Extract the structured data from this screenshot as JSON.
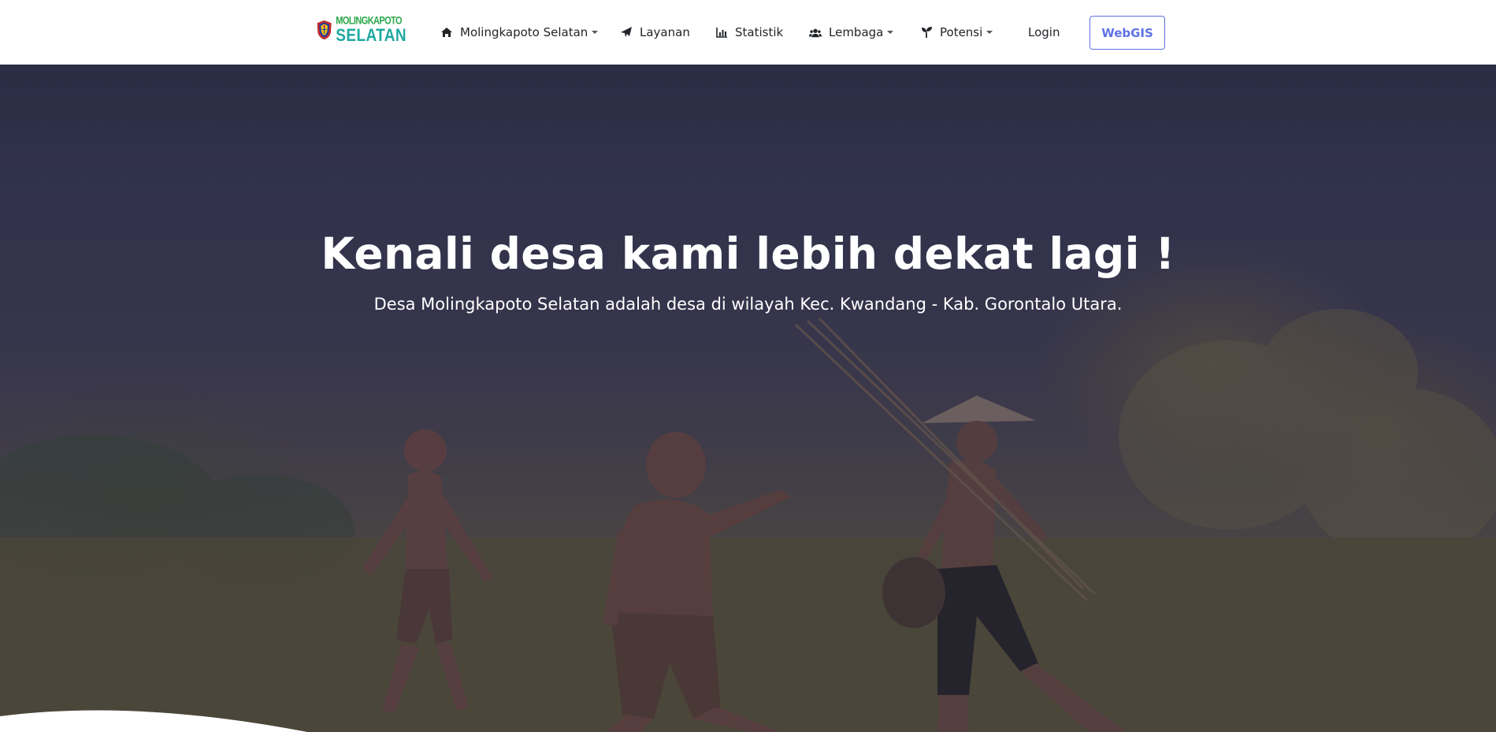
{
  "nav": {
    "logo": {
      "line1": "MOLINGKAPOTO",
      "line2": "SELATAN"
    },
    "items": [
      {
        "label": "Molingkapoto Selatan",
        "icon": "home-icon",
        "dropdown": true
      },
      {
        "label": "Layanan",
        "icon": "paper-plane-icon",
        "dropdown": false
      },
      {
        "label": "Statistik",
        "icon": "chart-bar-icon",
        "dropdown": false
      },
      {
        "label": "Lembaga",
        "icon": "users-icon",
        "dropdown": true
      },
      {
        "label": "Potensi",
        "icon": "seedling-icon",
        "dropdown": true
      }
    ],
    "login_label": "Login",
    "webgis_label": "WebGIS"
  },
  "hero": {
    "title": "Kenali desa kami lebih dekat lagi !",
    "subtitle": "Desa Molingkapoto Selatan adalah desa di wilayah Kec. Kwandang - Kab. Gorontalo Utara."
  },
  "colors": {
    "accent": "#5e72e4",
    "logo_green": "#2aa84a",
    "logo_teal": "#1ea9a0"
  }
}
